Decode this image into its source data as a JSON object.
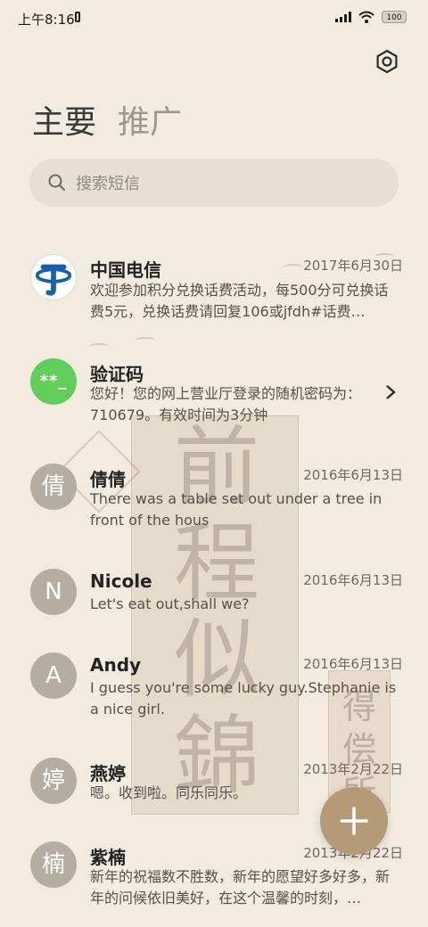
{
  "status_bar": {
    "time": "上午8:16",
    "battery": "100"
  },
  "header": {
    "tab_primary": "主要",
    "tab_secondary": "推广"
  },
  "search": {
    "placeholder": "搜索短信"
  },
  "decor": {
    "calligraphy": "前程似錦",
    "stamp": "得偿所"
  },
  "conversations": [
    {
      "name": "中国电信",
      "date": "2017年6月30日",
      "snippet": "欢迎参加积分兑换话费活动，每500分可兑换话费5元，兑换话费请回复106或jfdh#话费…",
      "avatar": ""
    },
    {
      "name": "验证码",
      "date": "",
      "snippet": "您好！您的网上营业厅登录的随机密码为：710679。有效时间为3分钟",
      "avatar": "**_"
    },
    {
      "name": "倩倩",
      "date": "2016年6月13日",
      "snippet": "There was a table set out under a tree in front of the hous",
      "avatar": "倩"
    },
    {
      "name": "Nicole",
      "date": "2016年6月13日",
      "snippet": "Let's eat out,shall we?",
      "avatar": "N"
    },
    {
      "name": "Andy",
      "date": "2016年6月13日",
      "snippet": "I guess you're some lucky guy.Stephanie is a nice girl.",
      "avatar": "A"
    },
    {
      "name": "燕婷",
      "date": "2013年2月22日",
      "snippet": "嗯。收到啦。同乐同乐。",
      "avatar": "婷"
    },
    {
      "name": "紫楠",
      "date": "2013年2月22日",
      "snippet": "新年的祝福数不胜数，新年的愿望好多好多，新年的问候依旧美好，在这个温馨的时刻，…",
      "avatar": "楠"
    }
  ],
  "colors": {
    "background": "#f2ebe0",
    "fab": "#b59a77",
    "code_avatar": "#62cf5d",
    "telecom_blue": "#1a5fae"
  }
}
